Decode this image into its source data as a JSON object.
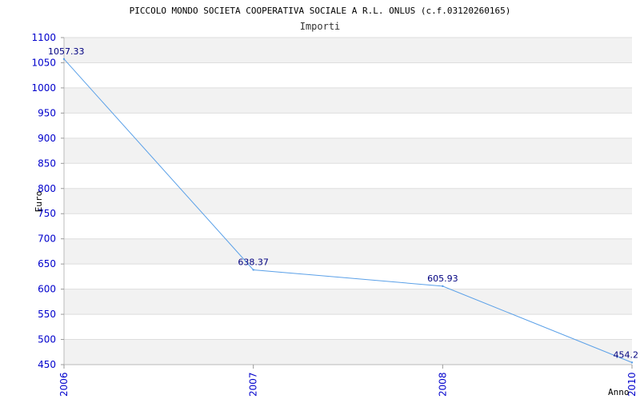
{
  "chart_data": {
    "type": "line",
    "title": "PICCOLO MONDO SOCIETA COOPERATIVA SOCIALE A R.L. ONLUS (c.f.03120260165)",
    "subtitle": "Importi",
    "xlabel": "Anno",
    "ylabel": "Euro",
    "categories": [
      "2006",
      "2007",
      "2008",
      "2010"
    ],
    "series": [
      {
        "values": [
          1057.33,
          638.37,
          605.93,
          454.2
        ],
        "labels": [
          "1057.33",
          "638.37",
          "605.93",
          "454.2"
        ]
      }
    ],
    "ylim": [
      450,
      1100
    ],
    "yticks": [
      450,
      500,
      550,
      600,
      650,
      700,
      750,
      800,
      850,
      900,
      950,
      1000,
      1050,
      1100
    ],
    "grid": true,
    "colors": {
      "line": "#5aa0e8",
      "tick_label": "#0000cc",
      "data_label": "#000080",
      "band": "#f2f2f2",
      "grid": "#dddddd",
      "title": "#000000"
    }
  }
}
